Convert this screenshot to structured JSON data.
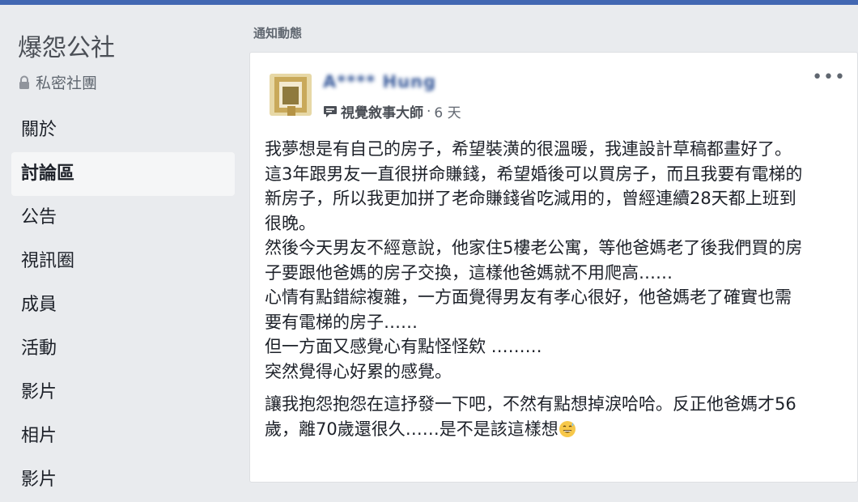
{
  "sidebar": {
    "group_name": "爆怨公社",
    "privacy": "私密社團",
    "icons": {
      "privacy": "lock-icon"
    },
    "nav_items": [
      {
        "label": "關於"
      },
      {
        "label": "討論區",
        "active": true
      },
      {
        "label": "公告"
      },
      {
        "label": "視訊圈"
      },
      {
        "label": "成員"
      },
      {
        "label": "活動"
      },
      {
        "label": "影片"
      },
      {
        "label": "相片"
      },
      {
        "label": "影片"
      }
    ]
  },
  "main": {
    "section_label": "通知動態",
    "post": {
      "author": "A**** Hung",
      "badge": "視覺敘事大師",
      "separator": "·",
      "time": "6 天",
      "more_label": "•••",
      "paragraph1": [
        "我夢想是有自己的房子，希望裝潢的很溫暖，我連設計草稿都畫好了。",
        "這3年跟男友一直很拼命賺錢，希望婚後可以買房子，而且我要有電梯的",
        "新房子，所以我更加拼了老命賺錢省吃減用的，曾經連續28天都上班到",
        "很晚。",
        "然後今天男友不經意說，他家住5樓老公寓，等他爸媽老了後我們買的房",
        "子要跟他爸媽的房子交換，這樣他爸媽就不用爬高……",
        "心情有點錯綜複雜，一方面覺得男友有孝心很好，他爸媽老了確實也需",
        "要有電梯的房子……",
        "但一方面又感覺心有點怪怪欸 ………",
        "突然覺得心好累的感覺。"
      ],
      "paragraph2": [
        "讓我抱怨抱怨在這抒發一下吧，不然有點想掉淚哈哈。反正他爸媽才56",
        "歲，離70歲還很久……是不是該這樣想"
      ],
      "icons": {
        "badge": "speech-bubble-icon",
        "emoji": "sweat-smile-emoji-icon",
        "avatar": "avatar"
      },
      "colors": {
        "author_link": "#365899",
        "brand": "#4267b2"
      }
    }
  }
}
